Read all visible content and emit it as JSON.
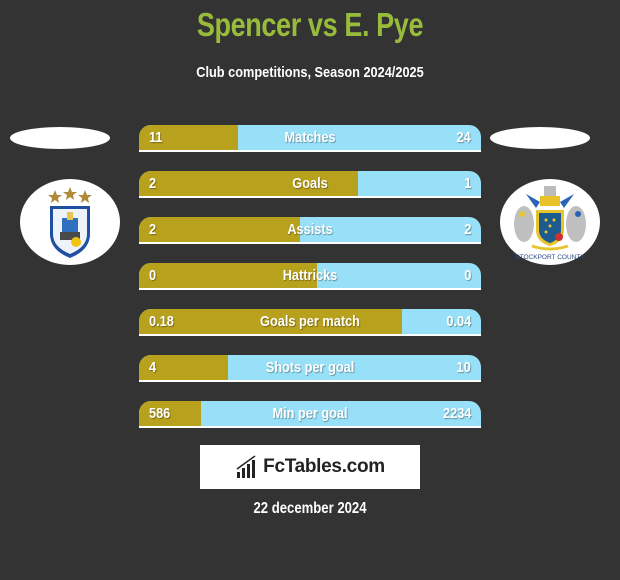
{
  "header": {
    "title": "Spencer vs E. Pye",
    "subtitle": "Club competitions, Season 2024/2025"
  },
  "teams": {
    "left": {
      "crest_icon": "huddersfield-town-crest-icon"
    },
    "right": {
      "crest_icon": "stockport-county-crest-icon",
      "crest_text": "STOCKPORT COUNTY"
    }
  },
  "colors": {
    "title": "#99bb3b",
    "left_bar": "#b8a11c",
    "right_bar": "#97e0f7",
    "background": "#333333"
  },
  "stats": [
    {
      "label": "Matches",
      "left": "11",
      "right": "24",
      "left_share": 0.29
    },
    {
      "label": "Goals",
      "left": "2",
      "right": "1",
      "left_share": 0.64
    },
    {
      "label": "Assists",
      "left": "2",
      "right": "2",
      "left_share": 0.47
    },
    {
      "label": "Hattricks",
      "left": "0",
      "right": "0",
      "left_share": 0.52
    },
    {
      "label": "Goals per match",
      "left": "0.18",
      "right": "0.04",
      "left_share": 0.77
    },
    {
      "label": "Shots per goal",
      "left": "4",
      "right": "10",
      "left_share": 0.26
    },
    {
      "label": "Min per goal",
      "left": "586",
      "right": "2234",
      "left_share": 0.18
    }
  ],
  "footer": {
    "brand": "FcTables.com",
    "brand_icon": "bar-chart-icon",
    "date": "22 december 2024"
  }
}
